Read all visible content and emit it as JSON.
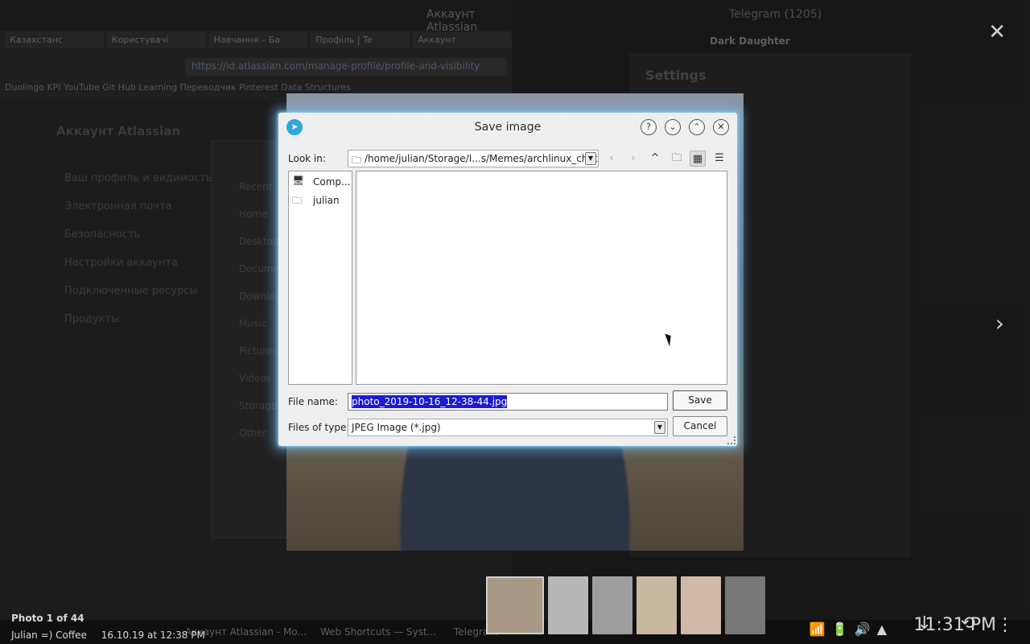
{
  "background": {
    "browser": {
      "window_title": "Аккаунт Atlassian",
      "tabs": [
        "Казахстанс",
        "Користувачі",
        "Навчання – Ба",
        "Профіль | Te",
        "Аккаунт"
      ],
      "url": "https://id.atlassian.com/manage-profile/profile-and-visibility",
      "bookmarks": "Duolingo  KPI  YouTube  Git Hub  Learning  Переводчик  Pinterest  Data Structures",
      "page_heading": "Аккаунт Atlassian",
      "menu": [
        "Ваш профиль и видимость",
        "Электронная почта",
        "Безопасность",
        "Настройки аккаунта",
        "Подключенные ресурсы",
        "Продукты"
      ],
      "file_panel": [
        "Recent",
        "Home",
        "Desktop",
        "Documents",
        "Downloads",
        "Music",
        "Pictures",
        "Videos",
        "Storage",
        "Other"
      ]
    },
    "telegram": {
      "window_title": "Telegram (1205)",
      "chat_name": "Dark Daughter",
      "settings_title": "Settings"
    }
  },
  "viewer": {
    "photo_counter": "Photo 1 of 44",
    "author": "Julian =) Coffee",
    "date": "16.10.19 at 12:38 PM"
  },
  "taskbar": {
    "tasks": [
      "Аккаунт Atlassian - Mo...",
      "Web Shortcuts — Syst...",
      "Telegram"
    ],
    "clock": "11:31 PM"
  },
  "dialog": {
    "title": "Save image",
    "look_in_label": "Look in:",
    "look_in_path": "/home/julian/Storage/I...s/Memes/archlinux_chat",
    "sidebar": [
      {
        "label": "Comp...",
        "icon": "computer-icon"
      },
      {
        "label": "julian",
        "icon": "folder-icon"
      }
    ],
    "file_name_label": "File name:",
    "file_name_value": "photo_2019-10-16_12-38-44.jpg",
    "file_type_label": "Files of type:",
    "file_type_value": "JPEG Image (*.jpg)",
    "save_label": "Save",
    "cancel_label": "Cancel",
    "colors": {
      "accent_glow": "#8fd3ff",
      "selection": "#1a1ad8",
      "telegram_blue": "#2ea6e0"
    }
  }
}
